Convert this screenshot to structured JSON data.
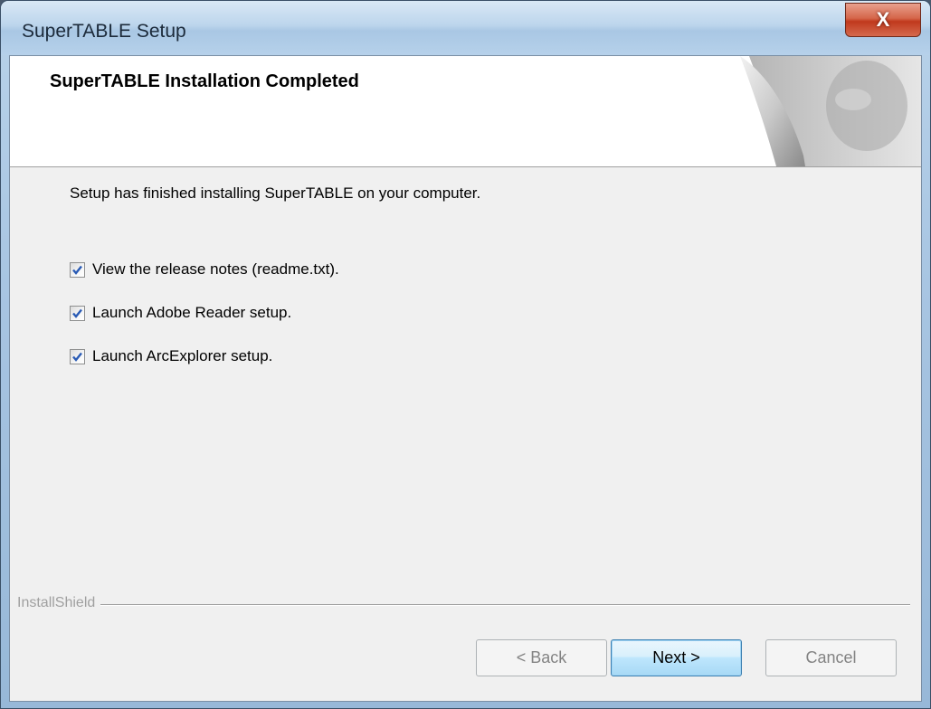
{
  "window": {
    "title": "SuperTABLE Setup",
    "close_glyph": "X"
  },
  "header": {
    "title": "SuperTABLE Installation Completed"
  },
  "body": {
    "message": "Setup has finished installing SuperTABLE on your computer.",
    "options": [
      {
        "label": "View the release notes (readme.txt).",
        "checked": true
      },
      {
        "label": "Launch Adobe Reader setup.",
        "checked": true
      },
      {
        "label": "Launch ArcExplorer setup.",
        "checked": true
      }
    ]
  },
  "footer": {
    "brand": "InstallShield",
    "back_label": "< Back",
    "next_label": "Next >",
    "cancel_label": "Cancel"
  },
  "colors": {
    "accent": "#3c7fb1",
    "close": "#c0391d",
    "checkmark": "#2a5bb5"
  }
}
